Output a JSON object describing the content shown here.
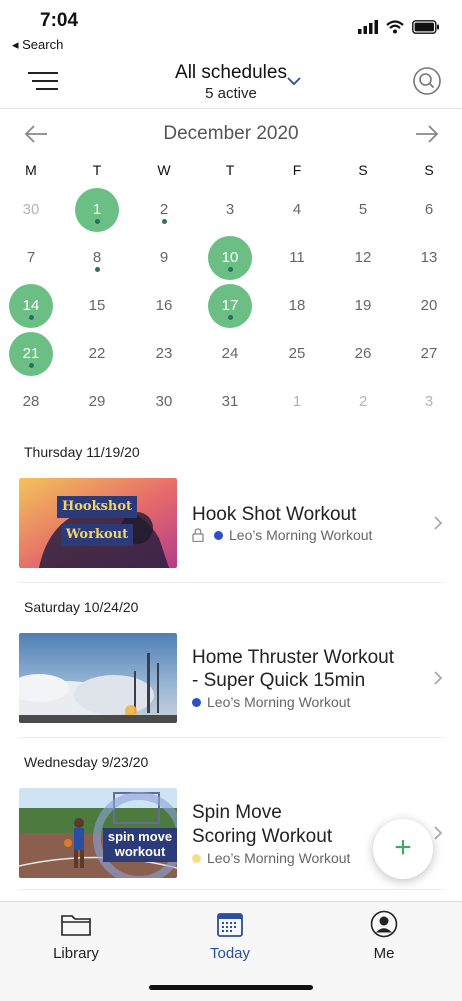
{
  "status_bar": {
    "time": "7:04",
    "back_label": "◂ Search"
  },
  "header": {
    "title": "All schedules",
    "subtitle": "5 active"
  },
  "calendar": {
    "month_title": "December 2020",
    "weekdays": [
      "M",
      "T",
      "W",
      "T",
      "F",
      "S",
      "S"
    ],
    "weeks": [
      [
        {
          "d": "30",
          "other": true
        },
        {
          "d": "1",
          "selected": true,
          "dot": true
        },
        {
          "d": "2",
          "dot": true
        },
        {
          "d": "3"
        },
        {
          "d": "4"
        },
        {
          "d": "5"
        },
        {
          "d": "6"
        }
      ],
      [
        {
          "d": "7"
        },
        {
          "d": "8",
          "dot": true
        },
        {
          "d": "9"
        },
        {
          "d": "10",
          "selected": true,
          "dot": true
        },
        {
          "d": "11"
        },
        {
          "d": "12"
        },
        {
          "d": "13"
        }
      ],
      [
        {
          "d": "14",
          "selected": true,
          "dot": true
        },
        {
          "d": "15"
        },
        {
          "d": "16"
        },
        {
          "d": "17",
          "selected": true,
          "dot": true
        },
        {
          "d": "18"
        },
        {
          "d": "19"
        },
        {
          "d": "20"
        }
      ],
      [
        {
          "d": "21",
          "selected": true,
          "dot": true
        },
        {
          "d": "22"
        },
        {
          "d": "23"
        },
        {
          "d": "24"
        },
        {
          "d": "25"
        },
        {
          "d": "26"
        },
        {
          "d": "27"
        }
      ],
      [
        {
          "d": "28"
        },
        {
          "d": "29"
        },
        {
          "d": "30"
        },
        {
          "d": "31"
        },
        {
          "d": "1",
          "other": true
        },
        {
          "d": "2",
          "other": true
        },
        {
          "d": "3",
          "other": true
        }
      ]
    ]
  },
  "sessions": [
    {
      "date": "Thursday 11/19/20",
      "title_line1": "Hook Shot Workout",
      "title_line2": "",
      "schedule": "Leo’s Morning Workout",
      "schedule_color": "#2f4fc9",
      "locked": true,
      "thumb_text_1": "Hookshot",
      "thumb_text_2": "Workout"
    },
    {
      "date": "Saturday 10/24/20",
      "title_line1": "Home Thruster Workout",
      "title_line2": "- Super Quick 15min",
      "schedule": "Leo’s Morning Workout",
      "schedule_color": "#2f4fc9",
      "locked": false
    },
    {
      "date": "Wednesday 9/23/20",
      "title_line1": "Spin Move",
      "title_line2": "Scoring Workout",
      "schedule": "Leo’s Morning Workout",
      "schedule_color": "#f4e08a",
      "locked": false,
      "thumb_text_1": "spin move",
      "thumb_text_2": "workout"
    }
  ],
  "fab_label": "+",
  "tabs": {
    "library": "Library",
    "today": "Today",
    "me": "Me"
  },
  "colors": {
    "accent_green": "#6cbf84",
    "accent_blue": "#2b4ea1"
  }
}
